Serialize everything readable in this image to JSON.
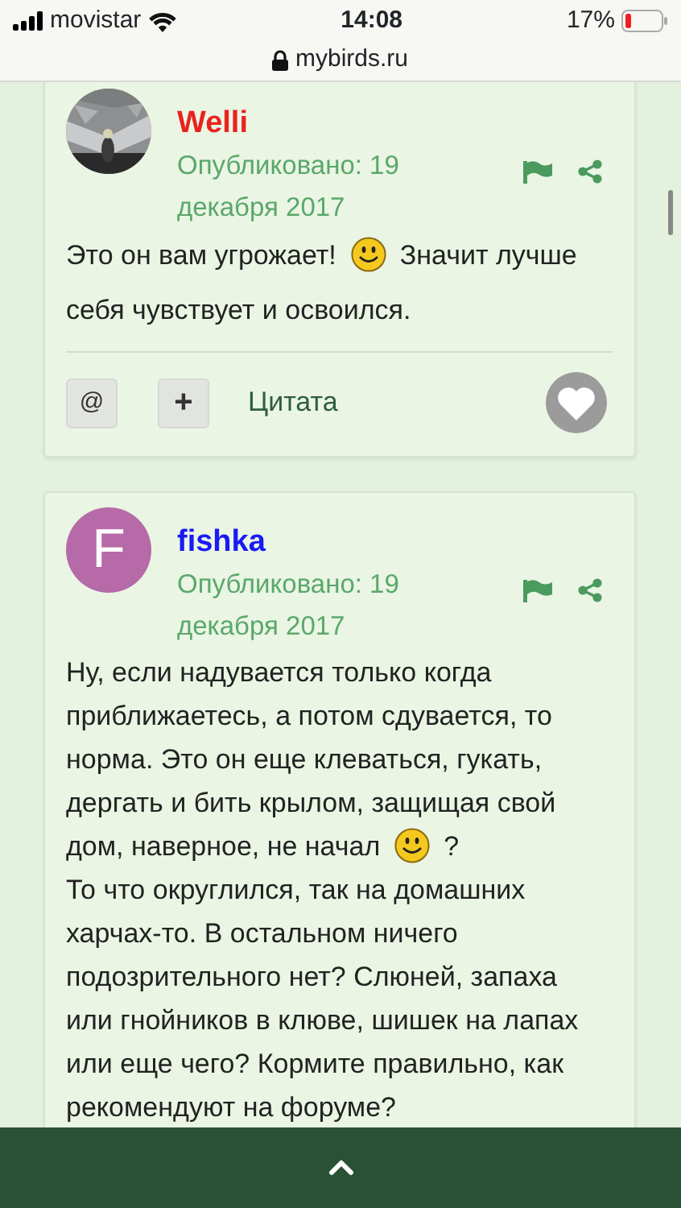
{
  "status_bar": {
    "carrier": "movistar",
    "time": "14:08",
    "battery": "17%"
  },
  "address_bar": {
    "url": "mybirds.ru"
  },
  "posts": [
    {
      "author": {
        "name": "Welli",
        "color": "#e8231f"
      },
      "avatar": {
        "kind": "picture"
      },
      "published": "Опубликовано: 19 декабря 2017",
      "body": [
        [
          {
            "kind": "text",
            "text": "Это он вам угрожает!"
          },
          {
            "kind": "smiley"
          },
          {
            "kind": "text",
            "text": "Значит лучше себя чувствует и освоился."
          }
        ]
      ],
      "actions": {
        "mention": "@",
        "multiquote": "+",
        "quote": "Цитата"
      }
    },
    {
      "author": {
        "name": "fishka",
        "color": "#1a1af5"
      },
      "avatar": {
        "kind": "letter",
        "letter": "F",
        "color": "#b66aa8"
      },
      "published": "Опубликовано: 19 декабря 2017",
      "body": [
        [
          {
            "kind": "text",
            "text": "Ну, если надувается только когда приближаетесь, а потом сдувается, то норма. Это он еще клеваться, гукать, дергать и бить крылом, защищая свой дом, наверное, не начал"
          },
          {
            "kind": "smiley"
          },
          {
            "kind": "text",
            "text": "?"
          }
        ],
        [
          {
            "kind": "text",
            "text": "То что округлился, так на домашних харчах-то. В остальном ничего подозрительного нет? Слюней, запаха или гнойников в клюве, шишек на лапах или еще чего? Кормите правильно, как рекомендуют на форуме?"
          }
        ]
      ]
    }
  ]
}
